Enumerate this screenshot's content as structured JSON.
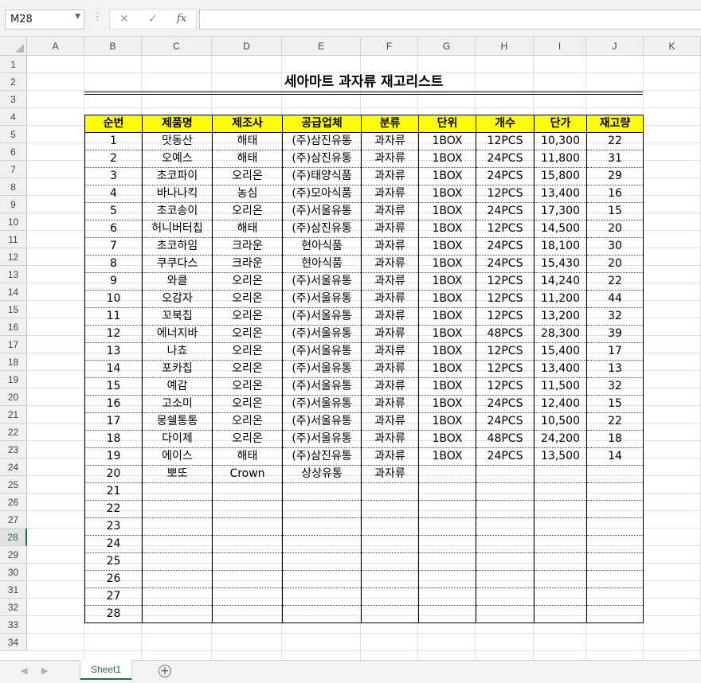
{
  "formula_bar": {
    "name_box": "M28",
    "cancel_icon": "✕",
    "enter_icon": "✓",
    "function_icon": "fx",
    "formula": ""
  },
  "columns": [
    "A",
    "B",
    "C",
    "D",
    "E",
    "F",
    "G",
    "H",
    "I",
    "J",
    "K"
  ],
  "rows": [
    "1",
    "2",
    "3",
    "4",
    "5",
    "6",
    "7",
    "8",
    "9",
    "10",
    "11",
    "12",
    "13",
    "14",
    "15",
    "16",
    "17",
    "18",
    "19",
    "20",
    "21",
    "22",
    "23",
    "24",
    "25",
    "26",
    "27",
    "28",
    "29",
    "30",
    "31",
    "32",
    "33",
    "34"
  ],
  "active_row": "28",
  "sheet": {
    "title": "세아마트 과자류 재고리스트",
    "headers": [
      "순번",
      "제품명",
      "제조사",
      "공급업체",
      "분류",
      "단위",
      "개수",
      "단가",
      "재고량"
    ],
    "rows": [
      [
        "1",
        "맛동산",
        "해태",
        "(주)삼진유통",
        "과자류",
        "1BOX",
        "12PCS",
        "10,300",
        "22"
      ],
      [
        "2",
        "오예스",
        "해태",
        "(주)삼진유통",
        "과자류",
        "1BOX",
        "24PCS",
        "11,800",
        "31"
      ],
      [
        "3",
        "초코파이",
        "오리온",
        "(주)태양식품",
        "과자류",
        "1BOX",
        "24PCS",
        "15,800",
        "29"
      ],
      [
        "4",
        "바나나킥",
        "농심",
        "(주)모아식품",
        "과자류",
        "1BOX",
        "12PCS",
        "13,400",
        "16"
      ],
      [
        "5",
        "초코송이",
        "오리온",
        "(주)서울유통",
        "과자류",
        "1BOX",
        "24PCS",
        "17,300",
        "15"
      ],
      [
        "6",
        "허니버터칩",
        "해태",
        "(주)삼진유통",
        "과자류",
        "1BOX",
        "12PCS",
        "14,500",
        "20"
      ],
      [
        "7",
        "초코하임",
        "크라운",
        "현아식품",
        "과자류",
        "1BOX",
        "24PCS",
        "18,100",
        "30"
      ],
      [
        "8",
        "쿠쿠다스",
        "크라운",
        "현아식품",
        "과자류",
        "1BOX",
        "24PCS",
        "15,430",
        "20"
      ],
      [
        "9",
        "와클",
        "오리온",
        "(주)서울유통",
        "과자류",
        "1BOX",
        "12PCS",
        "14,240",
        "22"
      ],
      [
        "10",
        "오감자",
        "오리온",
        "(주)서울유통",
        "과자류",
        "1BOX",
        "12PCS",
        "11,200",
        "44"
      ],
      [
        "11",
        "꼬북칩",
        "오리온",
        "(주)서울유통",
        "과자류",
        "1BOX",
        "12PCS",
        "13,200",
        "32"
      ],
      [
        "12",
        "에너지바",
        "오리온",
        "(주)서울유통",
        "과자류",
        "1BOX",
        "48PCS",
        "28,300",
        "39"
      ],
      [
        "13",
        "나쵸",
        "오리온",
        "(주)서울유통",
        "과자류",
        "1BOX",
        "12PCS",
        "15,400",
        "17"
      ],
      [
        "14",
        "포카칩",
        "오리온",
        "(주)서울유통",
        "과자류",
        "1BOX",
        "12PCS",
        "13,400",
        "13"
      ],
      [
        "15",
        "예감",
        "오리온",
        "(주)서울유통",
        "과자류",
        "1BOX",
        "12PCS",
        "11,500",
        "32"
      ],
      [
        "16",
        "고소미",
        "오리온",
        "(주)서울유통",
        "과자류",
        "1BOX",
        "24PCS",
        "12,400",
        "15"
      ],
      [
        "17",
        "몽쉘통통",
        "오리온",
        "(주)서울유통",
        "과자류",
        "1BOX",
        "24PCS",
        "10,500",
        "22"
      ],
      [
        "18",
        "다이제",
        "오리온",
        "(주)서울유통",
        "과자류",
        "1BOX",
        "48PCS",
        "24,200",
        "18"
      ],
      [
        "19",
        "에이스",
        "해태",
        "(주)삼진유통",
        "과자류",
        "1BOX",
        "24PCS",
        "13,500",
        "14"
      ],
      [
        "20",
        "뽀또",
        "Crown",
        "상상유통",
        "과자류",
        "",
        "",
        "",
        ""
      ],
      [
        "21",
        "",
        "",
        "",
        "",
        "",
        "",
        "",
        ""
      ],
      [
        "22",
        "",
        "",
        "",
        "",
        "",
        "",
        "",
        ""
      ],
      [
        "23",
        "",
        "",
        "",
        "",
        "",
        "",
        "",
        ""
      ],
      [
        "24",
        "",
        "",
        "",
        "",
        "",
        "",
        "",
        ""
      ],
      [
        "25",
        "",
        "",
        "",
        "",
        "",
        "",
        "",
        ""
      ],
      [
        "26",
        "",
        "",
        "",
        "",
        "",
        "",
        "",
        ""
      ],
      [
        "27",
        "",
        "",
        "",
        "",
        "",
        "",
        "",
        ""
      ],
      [
        "28",
        "",
        "",
        "",
        "",
        "",
        "",
        "",
        ""
      ]
    ]
  },
  "tabs": {
    "sheets": [
      "Sheet1"
    ],
    "add_icon": "+",
    "nav_left": "◀",
    "nav_right": "▶"
  },
  "colors": {
    "header_fill": "#ffff00",
    "accent": "#217346"
  }
}
